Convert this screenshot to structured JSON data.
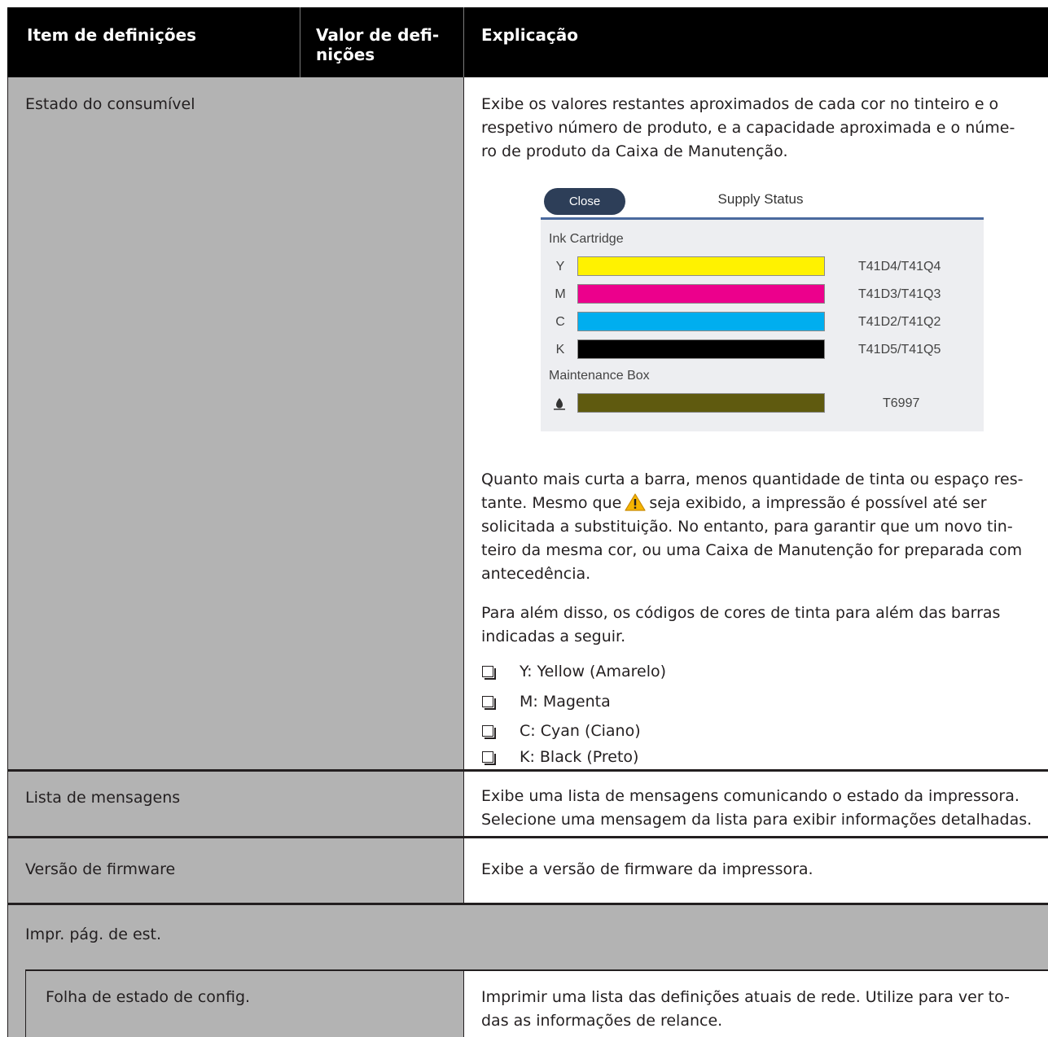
{
  "header": {
    "col1": "Item de definições",
    "col2_line1": "Valor de defi-",
    "col2_line2": "nições",
    "col3": "Explicação"
  },
  "rows": {
    "consumable": {
      "item": "Estado do consumível",
      "intro": [
        "Exibe os valores restantes aproximados de cada cor no tinteiro e o",
        "respetivo número de produto, e a capacidade aproximada e o núme-",
        "ro de produto da Caixa de Manutenção."
      ],
      "para1_line1": "Quanto mais curta a barra, menos quantidade de tinta ou espaço res-",
      "para1_line2_a": "tante. Mesmo que",
      "para1_line2_b": "seja exibido, a impressão é possível até ser",
      "para1_rest": [
        "solicitada a substituição. No entanto, para garantir que um novo tin-",
        "teiro da mesma cor, ou uma Caixa de Manutenção for preparada com",
        "antecedência."
      ],
      "para2": [
        "Para além disso, os códigos de cores de tinta para além das barras",
        "indicadas a seguir."
      ],
      "bullets": [
        "Y: Yellow (Amarelo)",
        "M: Magenta",
        "C: Cyan (Ciano)",
        "K: Black (Preto)"
      ]
    },
    "messages": {
      "item": "Lista de mensagens",
      "expl": [
        "Exibe uma lista de mensagens comunicando o estado da impressora.",
        "Selecione uma mensagem da lista para exibir informações detalhadas."
      ]
    },
    "firmware": {
      "item": "Versão de firmware",
      "expl": "Exibe a versão de firmware da impressora."
    },
    "status_page": {
      "item": "Impr. pág. de est."
    },
    "config_sheet": {
      "item": "Folha de estado de config.",
      "expl": [
        "Imprimir uma lista das definições atuais de rede. Utilize para ver to-",
        "das as informações de relance."
      ]
    }
  },
  "supply_panel": {
    "close_label": "Close",
    "title": "Supply Status",
    "ink_section": "Ink Cartridge",
    "inks": [
      {
        "letter": "Y",
        "code": "T41D4/T41Q4",
        "color": "#fff200",
        "level": 1.0
      },
      {
        "letter": "M",
        "code": "T41D3/T41Q3",
        "color": "#ec008c",
        "level": 1.0
      },
      {
        "letter": "C",
        "code": "T41D2/T41Q2",
        "color": "#00aeef",
        "level": 1.0
      },
      {
        "letter": "K",
        "code": "T41D5/T41Q5",
        "color": "#000000",
        "level": 1.0
      }
    ],
    "maintenance_section": "Maintenance Box",
    "maintenance": {
      "code": "T6997",
      "color": "#5f5a0f",
      "level": 1.0,
      "icon": "ink-drop-icon"
    }
  },
  "colors": {
    "header_bg": "#000000",
    "item_column_bg": "#b3b3b3",
    "panel_accent": "#2d3e58"
  }
}
